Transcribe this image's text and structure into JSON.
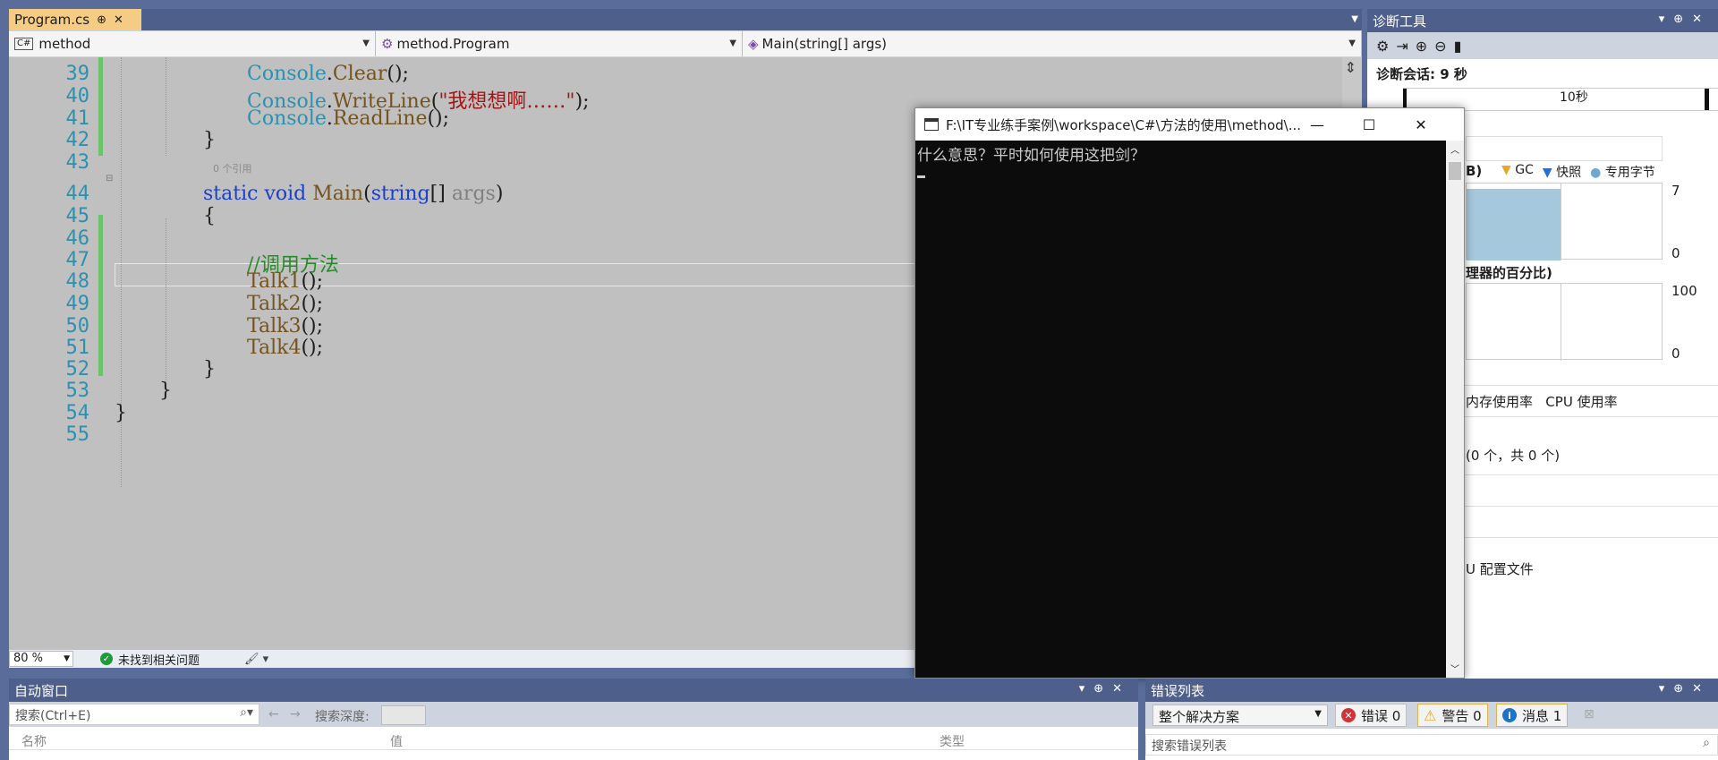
{
  "tab": {
    "label": "Program.cs",
    "pin": "⊕",
    "close": "✕"
  },
  "navbar": {
    "project": "method",
    "class": "method.Program",
    "member": "Main(string[] args)"
  },
  "code": {
    "line_numbers": [
      "39",
      "40",
      "41",
      "42",
      "43",
      "44",
      "45",
      "46",
      "47",
      "48",
      "49",
      "50",
      "51",
      "52",
      "53",
      "54",
      "55"
    ],
    "ref_hint": "0 个引用",
    "lines": {
      "l39_cls": "Console",
      "l39_rest": ".",
      "l39_meth": "Clear",
      "l39_end": "();",
      "l40_cls": "Console",
      "l40_dot": ".",
      "l40_meth": "WriteLine",
      "l40_open": "(",
      "l40_str": "\"我想想啊……\"",
      "l40_end": ");",
      "l41_cls": "Console",
      "l41_dot": ".",
      "l41_meth": "ReadLine",
      "l41_end": "();",
      "l42": "}",
      "l44_kw1": "static",
      "l44_kw2": "void",
      "l44_meth": "Main",
      "l44_open": "(",
      "l44_kw3": "string",
      "l44_br": "[] ",
      "l44_par": "args",
      "l44_end": ")",
      "l45": "{",
      "l47": "//调用方法",
      "l48_meth": "Talk1",
      "l48_end": "();",
      "l49_meth": "Talk2",
      "l49_end": "();",
      "l50_meth": "Talk3",
      "l50_end": "();",
      "l51_meth": "Talk4",
      "l51_end": "();",
      "l52": "}",
      "l53": "}",
      "l54": "}"
    }
  },
  "editor_status": {
    "zoom": "80 %",
    "issues": "未找到相关问题"
  },
  "console": {
    "title": "F:\\IT专业练手案例\\workspace\\C#\\方法的使用\\method\\...",
    "output": "什么意思？平时如何使用这把剑？"
  },
  "diag": {
    "title": "诊断工具",
    "session": "诊断会话: 9 秒",
    "tick": "10秒",
    "mem_header_suffix": "B)",
    "legend_gc": "GC",
    "legend_snap": "快照",
    "legend_bytes": "专用字节",
    "mem_max": "7",
    "mem_min": "0",
    "cpu_header": "理器的百分比)",
    "cpu_max": "100",
    "cpu_min": "0",
    "tabs": "内存使用率   CPU 使用率",
    "events": "(0 个，共 0 个)",
    "profile": "U 配置文件"
  },
  "autos": {
    "title": "自动窗口",
    "search_placeholder": "搜索(Ctrl+E)",
    "depth_label": "搜索深度:",
    "col_name": "名称",
    "col_value": "值",
    "col_type": "类型"
  },
  "errors": {
    "title": "错误列表",
    "scope": "整个解决方案",
    "errors_label": "错误 0",
    "warnings_label": "警告 0",
    "messages_label": "消息 1",
    "search_placeholder": "搜索错误列表"
  }
}
